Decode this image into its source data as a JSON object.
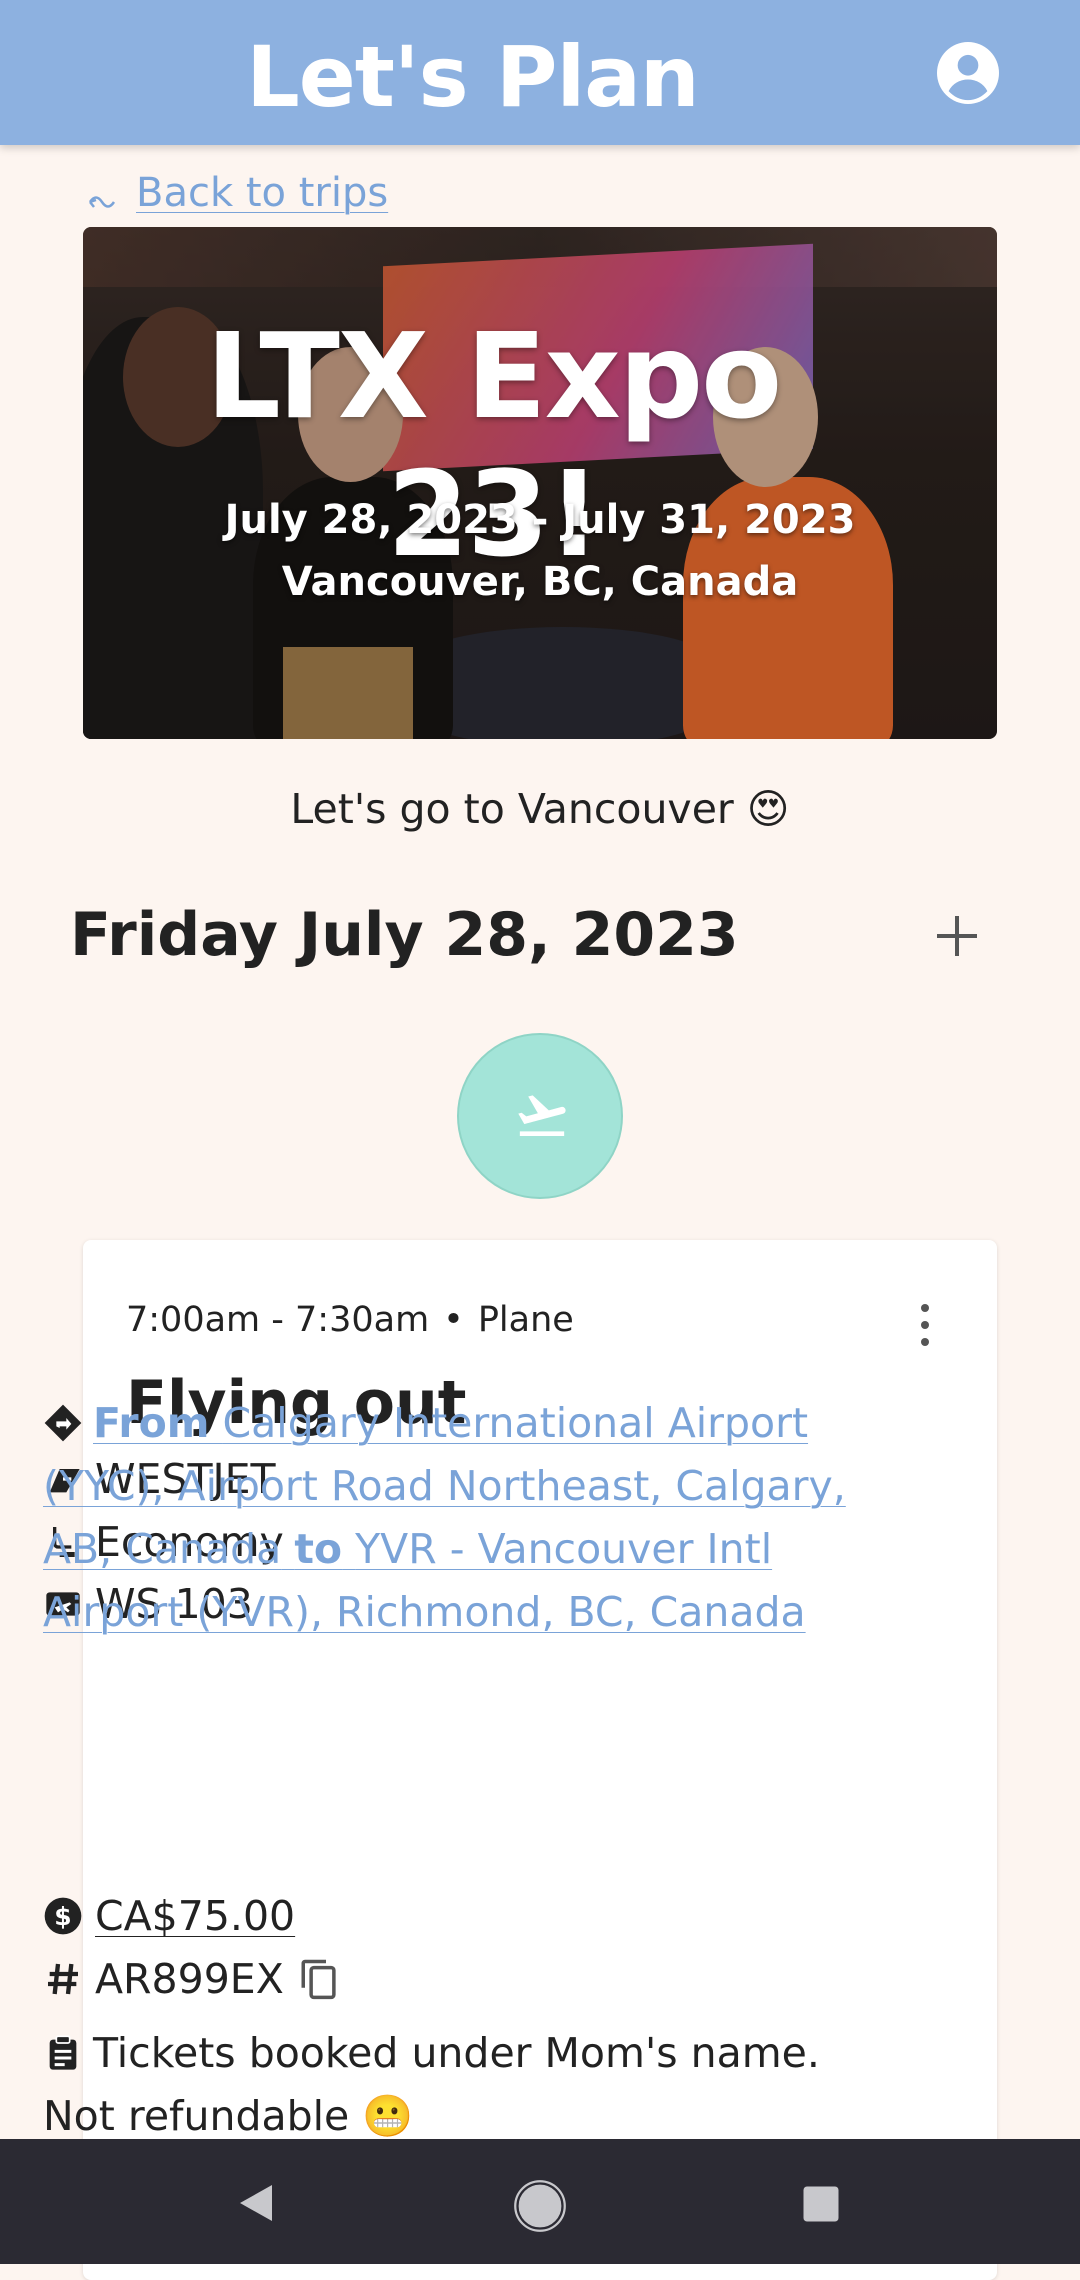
{
  "header": {
    "title": "Let's Plan",
    "account_icon": "account-circle-icon"
  },
  "back_link": {
    "label": "Back to trips",
    "icon": "back-wave-icon"
  },
  "trip": {
    "title": "LTX Expo 23!",
    "dates": "July 28, 2023 - July 31, 2023",
    "location": "Vancouver, BC, Canada",
    "description": "Let's go to Vancouver 😍"
  },
  "day": {
    "heading": "Friday July 28, 2023",
    "add_icon": "plus-icon"
  },
  "activity_icon": "plane-takeoff-icon",
  "card": {
    "time": "7:00am - 7:30am",
    "separator": "•",
    "type": "Plane",
    "title": "Flying out",
    "airline": "WESTJET",
    "class": "Economy",
    "flight": "WS 103",
    "route": {
      "from_label": "From",
      "from": "Calgary International Airport (YYC), Airport Road Northeast, Calgary, AB, Canada",
      "to_label": "to",
      "to": "YVR - Vancouver Intl Airport (YVR), Richmond, BC, Canada"
    },
    "price": "CA$75.00",
    "confirmation": "AR899EX",
    "notes": "Tickets booked under Mom's name. Not refundable 😬"
  },
  "colors": {
    "header": "#8db1e0",
    "background": "#fdf5f0",
    "link": "#7aa3d8",
    "activity_circle": "#a3e4d8",
    "navbar": "#2b2a33"
  }
}
